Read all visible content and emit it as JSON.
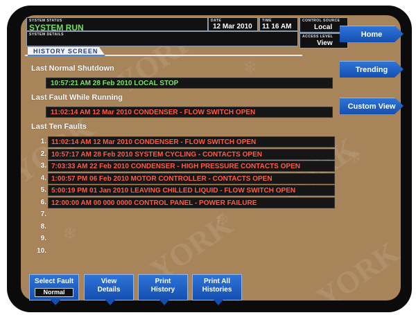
{
  "header": {
    "system_status_caption": "SYSTEM STATUS",
    "system_status": "SYSTEM RUN",
    "system_details_caption": "SYSTEM DETAILS",
    "date_caption": "DATE",
    "date": "12 Mar 2010",
    "time_caption": "TIME",
    "time": "11 16 AM",
    "control_source_caption": "CONTROL SOURCE",
    "control_source": "Local",
    "access_level_caption": "ACCESS LEVEL",
    "access_level": "View"
  },
  "screen_tab": "HISTORY SCREEN",
  "watermark": "YORK",
  "last_normal_shutdown": {
    "label": "Last Normal Shutdown",
    "entry": "10:57:21 AM  28 Feb 2010  LOCAL STOP"
  },
  "last_fault_running": {
    "label": "Last Fault While Running",
    "entry": "11:02:14 AM  12 Mar 2010  CONDENSER - FLOW SWITCH OPEN"
  },
  "last_ten_faults": {
    "label": "Last Ten Faults",
    "rows": [
      {
        "num": "1.",
        "text": "11:02:14 AM  12 Mar 2010  CONDENSER - FLOW SWITCH OPEN"
      },
      {
        "num": "2.",
        "text": "10:57:17 AM  28 Feb 2010  SYSTEM CYCLING - CONTACTS OPEN"
      },
      {
        "num": "3.",
        "text": "7:03:33 AM  22 Feb 2010  CONDENSER - HIGH PRESSURE CONTACTS OPEN"
      },
      {
        "num": "4.",
        "text": "1:00:57 PM  06 Feb 2010  MOTOR CONTROLLER - CONTACTS OPEN"
      },
      {
        "num": "5.",
        "text": "5:00:19 PM  01 Jan 2010  LEAVING CHILLED LIQUID - FLOW SWITCH OPEN"
      },
      {
        "num": "6.",
        "text": "12:00:00 AM  00 000 0000  CONTROL PANEL - POWER FAILURE"
      },
      {
        "num": "7.",
        "text": ""
      },
      {
        "num": "8.",
        "text": ""
      },
      {
        "num": "9.",
        "text": ""
      },
      {
        "num": "10.",
        "text": ""
      }
    ]
  },
  "nav": {
    "home": "Home",
    "trending": "Trending",
    "custom_view": "Custom View"
  },
  "bottom": {
    "select_fault": "Select Fault",
    "select_fault_value": "Normal",
    "view_details_1": "View",
    "view_details_2": "Details",
    "print_history_1": "Print",
    "print_history_2": "History",
    "print_all_1": "Print All",
    "print_all_2": "Histories"
  },
  "colors": {
    "background": "#a8845b",
    "status_green": "#7ee06a",
    "fault_red": "#ff5a45",
    "button_blue": "#1f62c4"
  }
}
